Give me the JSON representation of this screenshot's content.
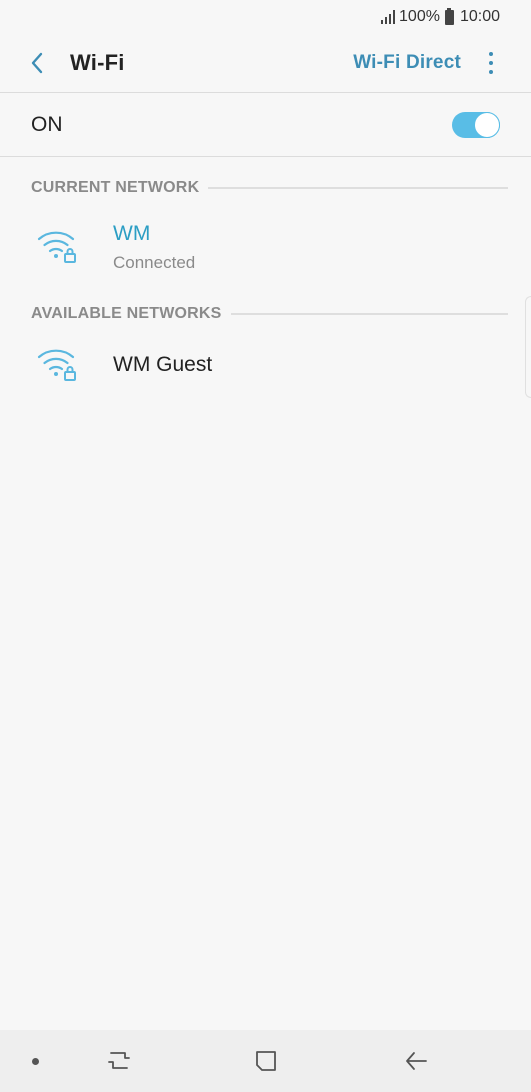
{
  "status_bar": {
    "battery": "100%",
    "time": "10:00"
  },
  "app_bar": {
    "title": "Wi-Fi",
    "wifi_direct": "Wi-Fi Direct"
  },
  "master_switch": {
    "label": "ON",
    "state": true
  },
  "current_network": {
    "header": "CURRENT NETWORK",
    "name": "WM",
    "status": "Connected"
  },
  "available_networks": {
    "header": "AVAILABLE NETWORKS",
    "items": [
      {
        "name": "WM Guest"
      }
    ]
  },
  "colors": {
    "accent": "#3d8db5",
    "toggle": "#59bde6",
    "wifi_icon": "#5ab7df"
  }
}
